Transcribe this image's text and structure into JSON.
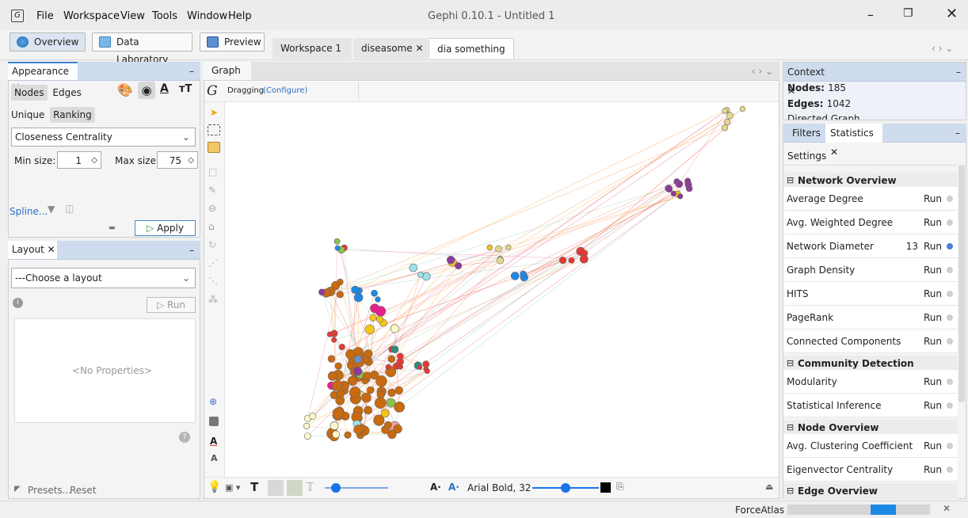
{
  "window": {
    "title": "Gephi 0.10.1 - Untitled 1"
  },
  "menu": [
    "File",
    "Workspace",
    "View",
    "Tools",
    "Window",
    "Help"
  ],
  "toolbar": {
    "overview": "Overview",
    "data_lab": "Data Laboratory",
    "preview": "Preview"
  },
  "workspace_tabs": [
    {
      "label": "Workspace 1"
    },
    {
      "label": "diseasome"
    },
    {
      "label": "dia something"
    }
  ],
  "appearance": {
    "title": "Appearance",
    "tab_nodes": "Nodes",
    "tab_edges": "Edges",
    "mode_unique": "Unique",
    "mode_ranking": "Ranking",
    "attribute": "Closeness Centrality",
    "min_label": "Min size:",
    "min_value": "1",
    "max_label": "Max size:",
    "max_value": "75",
    "spline": "Spline...",
    "apply": "Apply"
  },
  "layout": {
    "title": "Layout",
    "choose": "---Choose a layout",
    "run": "Run",
    "no_props": "<No Properties>",
    "presets": "Presets...",
    "reset": "Reset"
  },
  "graph": {
    "title": "Graph",
    "dragging": "Dragging",
    "configure": "(Configure)",
    "font": "Arial Bold, 32"
  },
  "context": {
    "title": "Context",
    "nodes_label": "Nodes:",
    "nodes_value": "185",
    "edges_label": "Edges:",
    "edges_value": "1042",
    "graph_type": "Directed Graph"
  },
  "stats": {
    "tab_filters": "Filters",
    "tab_statistics": "Statistics",
    "settings": "Settings",
    "sec_network": "Network Overview",
    "sec_community": "Community Detection",
    "sec_node": "Node Overview",
    "sec_edge": "Edge Overview",
    "run": "Run",
    "network": [
      {
        "label": "Average Degree"
      },
      {
        "label": "Avg. Weighted Degree"
      },
      {
        "label": "Network Diameter",
        "value": "13"
      },
      {
        "label": "Graph Density"
      },
      {
        "label": "HITS"
      },
      {
        "label": "PageRank"
      },
      {
        "label": "Connected Components"
      }
    ],
    "community": [
      {
        "label": "Modularity"
      },
      {
        "label": "Statistical Inference"
      }
    ],
    "node": [
      {
        "label": "Avg. Clustering Coefficient"
      },
      {
        "label": "Eigenvector Centrality"
      }
    ]
  },
  "status": {
    "layout_name": "ForceAtlas 2",
    "progress": 0.33
  },
  "colors": {
    "accent": "#cfdcee",
    "node_brown": "#c96a0e",
    "node_purple": "#8e3a9c",
    "node_blue": "#1e88e5",
    "node_red": "#e53935"
  }
}
